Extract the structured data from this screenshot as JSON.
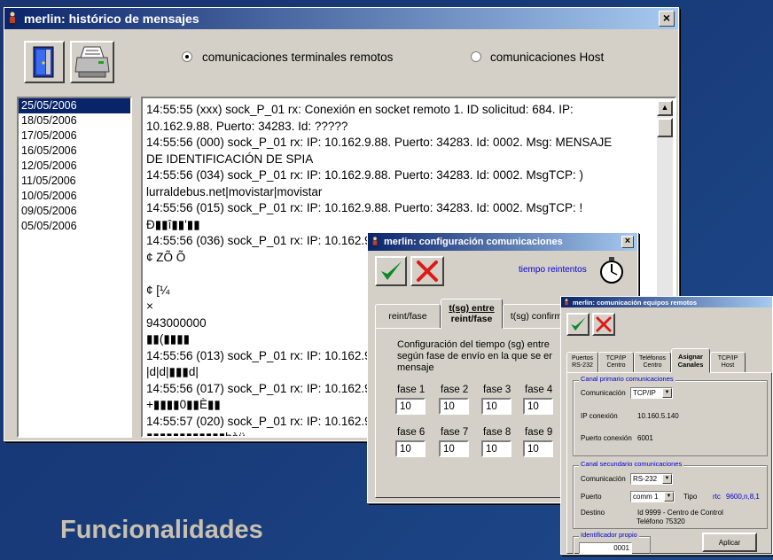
{
  "w1": {
    "title": "merlin: histórico de mensajes",
    "close": "×",
    "radio1": "comunicaciones terminales remotos",
    "radio2": "comunicaciones Host",
    "dates": [
      "25/05/2006",
      "18/05/2006",
      "17/05/2006",
      "16/05/2006",
      "12/05/2006",
      "11/05/2006",
      "10/05/2006",
      "09/05/2006",
      "05/05/2006"
    ],
    "log": [
      "14:55:55 (xxx) sock_P_01 rx: Conexión en socket remoto 1. ID solicitud: 684. IP:",
      "10.162.9.88. Puerto: 34283. Id: ?????",
      "14:55:56 (000) sock_P_01 rx: IP: 10.162.9.88. Puerto: 34283. Id: 0002. Msg: MENSAJE",
      "DE IDENTIFICACIÓN DE SPIA",
      "14:55:56 (034) sock_P_01 rx: IP: 10.162.9.88. Puerto: 34283. Id: 0002. MsgTCP: )",
      "lurraldebus.net|movistar|movistar",
      "14:55:56 (015) sock_P_01 rx: IP: 10.162.9.88. Puerto: 34283. Id: 0002. MsgTCP: !",
      "Ð▮▮î▮▮'▮▮",
      "14:55:56 (036) sock_P_01 rx: IP: 10.162.9.88. Puerto: 34283. Id: 0002. MsgTCP: !!",
      "¢            ZÕ            Õ",
      "",
      "¢            [¼",
      "×",
      "943000000",
      "▮▮(▮▮▮▮",
      "14:55:56 (013) sock_P_01 rx: IP: 10.162.9.88.",
      "|d|d|▮▮▮d|",
      "14:55:56 (017) sock_P_01 rx: IP: 10.162.9.88.",
      "+▮▮▮▮0▮▮È▮▮",
      "14:55:57 (020) sock_P_01 rx: IP: 10.162.9.88.",
      "▮▮▮▮▮▮▮▮▮▮▮▮bàü"
    ]
  },
  "w2": {
    "title": "merlin: configuración comunicaciones",
    "close": "×",
    "tiempo": "tiempo reintentos",
    "tab1": "reint/fase",
    "tab2a": "t(sg) entre",
    "tab2b": "reint/fase",
    "tab3": "t(sg) confirm",
    "desc": [
      "Configuración del tiempo (sg) entre",
      "según fase de envío en la que se er",
      "mensaje"
    ],
    "fases": [
      {
        "label": "fase 1",
        "value": "10"
      },
      {
        "label": "fase 2",
        "value": "10"
      },
      {
        "label": "fase 3",
        "value": "10"
      },
      {
        "label": "fase 4",
        "value": "10"
      },
      {
        "label": "fase 6",
        "value": "10"
      },
      {
        "label": "fase 7",
        "value": "10"
      },
      {
        "label": "fase 8",
        "value": "10"
      },
      {
        "label": "fase 9",
        "value": "10"
      }
    ]
  },
  "w3": {
    "title": "merlin: comunicación equipos remotos",
    "tabs": [
      {
        "l1": "Puertos",
        "l2": "RS-232"
      },
      {
        "l1": "TCP/IP",
        "l2": "Centro"
      },
      {
        "l1": "Teléfonos",
        "l2": "Centro"
      },
      {
        "l1": "Asignar",
        "l2": "Canales"
      },
      {
        "l1": "TCP/IP",
        "l2": "Host"
      }
    ],
    "g1": "Canal primario comunicaciones",
    "comunicacion_label": "Comunicación",
    "comunicacion1": "TCP/IP",
    "ip_label": "IP conexión",
    "ip": "10.160.5.140",
    "puerto_con_label": "Puerto conexión",
    "puerto_con": "6001",
    "g2": "Canal secundario comunicaciones",
    "comunicacion2": "RS-232",
    "puerto_label": "Puerto",
    "puerto": "comm 1",
    "tipo_label": "Tipo",
    "tipo": "rtc",
    "tipo_val": "9600,n,8,1",
    "destino_label": "Destino",
    "destino": "Id  9999   -  Centro de Control",
    "telefono": "Teléfono  75320",
    "g3": "Identificador propio",
    "ident": "0001",
    "aplicar": "Aplicar"
  },
  "caption": "Funcionalidades"
}
